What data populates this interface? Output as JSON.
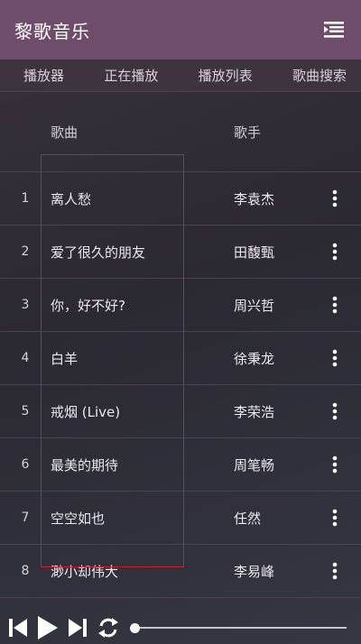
{
  "app": {
    "title": "黎歌音乐"
  },
  "tabs": [
    {
      "label": "播放器"
    },
    {
      "label": "正在播放"
    },
    {
      "label": "播放列表"
    },
    {
      "label": "歌曲搜索"
    }
  ],
  "list": {
    "header": {
      "song": "歌曲",
      "artist": "歌手"
    },
    "rows": [
      {
        "num": "1",
        "title": "离人愁",
        "artist": "李袁杰"
      },
      {
        "num": "2",
        "title": "爱了很久的朋友",
        "artist": "田馥甄"
      },
      {
        "num": "3",
        "title": "你，好不好?",
        "artist": "周兴哲"
      },
      {
        "num": "4",
        "title": "白羊",
        "artist": "徐秉龙"
      },
      {
        "num": "5",
        "title": "戒烟 (Live)",
        "artist": "李荣浩"
      },
      {
        "num": "6",
        "title": "最美的期待",
        "artist": "周笔畅"
      },
      {
        "num": "7",
        "title": "空空如也",
        "artist": "任然"
      },
      {
        "num": "8",
        "title": "渺小却伟大",
        "artist": "李易峰"
      }
    ]
  },
  "player": {
    "progress": 0.0
  },
  "colors": {
    "titlebar": "#6e4d6a",
    "highlight": "#c8202a",
    "text": "#ece8ef"
  },
  "icons": {
    "menu": "menu-list-icon",
    "row_more": "more-vertical-icon",
    "prev": "skip-previous-icon",
    "play": "play-icon",
    "next": "skip-next-icon",
    "repeat": "repeat-icon"
  }
}
